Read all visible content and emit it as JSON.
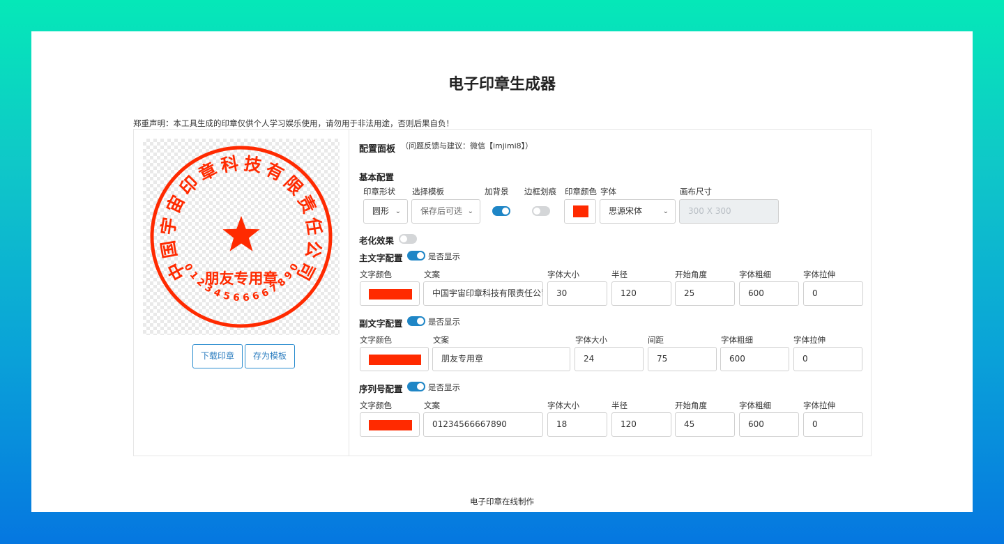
{
  "page": {
    "title": "电子印章生成器",
    "disclaimer": "郑重声明：本工具生成的印章仅供个人学习娱乐使用，请勿用于非法用途，否则后果自负！",
    "footer": "电子印章在线制作"
  },
  "stamp": {
    "main_text": "中国宇宙印章科技有限责任公司",
    "sub_text": "朋友专用章",
    "serial": "01234566667890",
    "color": "#ff2a00",
    "star_icon": "star-icon"
  },
  "actions": {
    "download_label": "下载印章",
    "save_template_label": "存为模板"
  },
  "panel": {
    "title": "配置面板",
    "note": "（问题反馈与建议：微信【imjimi8】）"
  },
  "basic": {
    "section": "基本配置",
    "shape_label": "印章形状",
    "shape_value": "圆形",
    "template_label": "选择模板",
    "template_value": "保存后可选",
    "bg_label": "加背景",
    "bg_on": true,
    "border_label": "边框划痕",
    "border_on": false,
    "color_label": "印章颜色",
    "color": "#ff2a00",
    "font_label": "字体",
    "font_value": "思源宋体",
    "canvas_label": "画布尺寸",
    "canvas_value": "300 X 300"
  },
  "aging": {
    "label": "老化效果",
    "on": false
  },
  "main_text_cfg": {
    "section": "主文字配置",
    "show_label": "是否显示",
    "on": true,
    "labels": {
      "color": "文字颜色",
      "text": "文案",
      "size": "字体大小",
      "radius": "半径",
      "angle": "开始角度",
      "weight": "字体粗细",
      "stretch": "字体拉伸"
    },
    "values": {
      "color": "#ff2a00",
      "text": "中国宇宙印章科技有限责任公司",
      "size": "30",
      "radius": "120",
      "angle": "25",
      "weight": "600",
      "stretch": "0"
    }
  },
  "sub_text_cfg": {
    "section": "副文字配置",
    "show_label": "是否显示",
    "on": true,
    "labels": {
      "color": "文字颜色",
      "text": "文案",
      "size": "字体大小",
      "spacing": "间距",
      "weight": "字体粗细",
      "stretch": "字体拉伸"
    },
    "values": {
      "color": "#ff2a00",
      "text": "朋友专用章",
      "size": "24",
      "spacing": "75",
      "weight": "600",
      "stretch": "0"
    }
  },
  "serial_cfg": {
    "section": "序列号配置",
    "show_label": "是否显示",
    "on": true,
    "labels": {
      "color": "文字颜色",
      "text": "文案",
      "size": "字体大小",
      "radius": "半径",
      "angle": "开始角度",
      "weight": "字体粗细",
      "stretch": "字体拉伸"
    },
    "values": {
      "color": "#ff2a00",
      "text": "01234566667890",
      "size": "18",
      "radius": "120",
      "angle": "45",
      "weight": "600",
      "stretch": "0"
    }
  }
}
